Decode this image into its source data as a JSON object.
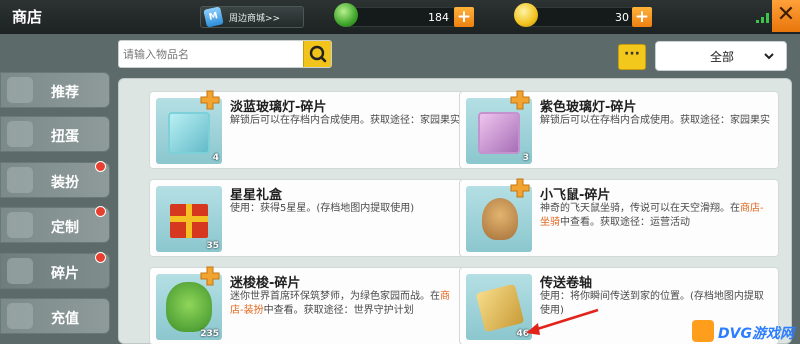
{
  "header": {
    "title": "商店",
    "mall_icon_text": "M",
    "mall_label": "周边商城>>",
    "gem_count": "184",
    "coin_count": "30",
    "plus_label": "+",
    "close_label": "✕"
  },
  "search": {
    "placeholder": "请输入物品名"
  },
  "toolbar": {
    "more_label": "···",
    "filter_value": "全部"
  },
  "sidebar": {
    "items": [
      {
        "label": "推荐",
        "dot": false
      },
      {
        "label": "扭蛋",
        "dot": false
      },
      {
        "label": "装扮",
        "dot": true
      },
      {
        "label": "定制",
        "dot": true
      },
      {
        "label": "碎片",
        "dot": true
      },
      {
        "label": "充值",
        "dot": false
      }
    ]
  },
  "items": [
    {
      "name": "淡蓝玻璃灯-碎片",
      "count": "4",
      "desc": "解锁后可以在存档内合成使用。获取途径：家园果实"
    },
    {
      "name": "紫色玻璃灯-碎片",
      "count": "3",
      "desc": "解锁后可以在存档内合成使用。获取途径：家园果实"
    },
    {
      "name": "星星礼盒",
      "count": "35",
      "desc": "使用：获得5星星。(存档地图内提取使用)"
    },
    {
      "name": "小飞鼠-碎片",
      "count": "",
      "desc_pre": "神奇的飞天鼠坐骑，传说可以在天空滑翔。在",
      "desc_link": "商店-坐骑",
      "desc_post": "中查看。获取途径：运营活动"
    },
    {
      "name": "迷梭梭-碎片",
      "count": "235",
      "desc_pre": "迷你世界首席环保筑梦师，为绿色家园而战。在",
      "desc_link": "商店-装扮",
      "desc_post": "中查看。获取途径：世界守护计划"
    },
    {
      "name": "传送卷轴",
      "count": "46",
      "desc": "使用：将你瞬间传送到家的位置。(存档地图内提取使用)"
    }
  ],
  "watermark": {
    "text": "DVG游戏网"
  },
  "colors": {
    "accent_orange": "#ee8011",
    "accent_yellow": "#f3c81c",
    "link_orange": "#e4661d",
    "notification_red": "#e84030"
  }
}
